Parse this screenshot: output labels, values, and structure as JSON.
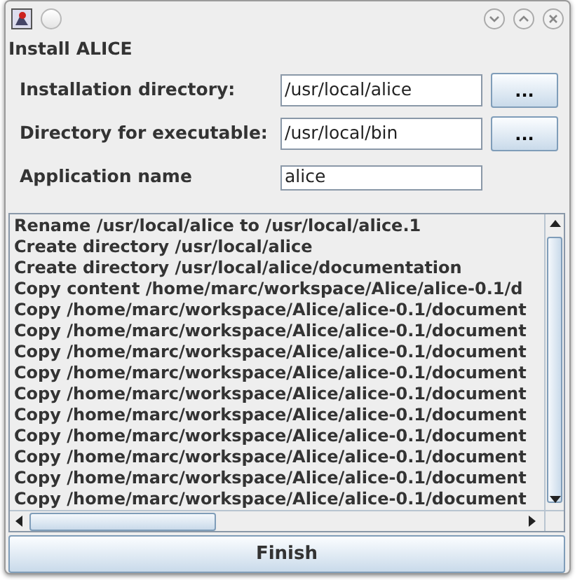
{
  "window": {
    "title": "Install ALICE"
  },
  "fields": [
    {
      "label": "Installation directory:",
      "value": "/usr/local/alice",
      "browse": "..."
    },
    {
      "label": "Directory for executable:",
      "value": "/usr/local/bin",
      "browse": "..."
    },
    {
      "label": "Application name",
      "value": "alice"
    }
  ],
  "log": [
    "Rename /usr/local/alice to /usr/local/alice.1",
    "Create directory /usr/local/alice",
    "Create directory /usr/local/alice/documentation",
    "Copy content /home/marc/workspace/Alice/alice-0.1/d",
    "Copy /home/marc/workspace/Alice/alice-0.1/document",
    "Copy /home/marc/workspace/Alice/alice-0.1/document",
    "Copy /home/marc/workspace/Alice/alice-0.1/document",
    "Copy /home/marc/workspace/Alice/alice-0.1/document",
    "Copy /home/marc/workspace/Alice/alice-0.1/document",
    "Copy /home/marc/workspace/Alice/alice-0.1/document",
    "Copy /home/marc/workspace/Alice/alice-0.1/document",
    "Copy /home/marc/workspace/Alice/alice-0.1/document",
    "Copy /home/marc/workspace/Alice/alice-0.1/document",
    "Copy /home/marc/workspace/Alice/alice-0.1/document"
  ],
  "finish_button": "Finish"
}
